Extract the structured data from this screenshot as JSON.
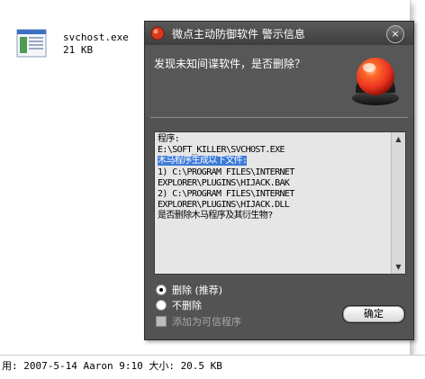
{
  "explorer": {
    "file": {
      "name": "svchost.exe",
      "size": "21 KB"
    },
    "status_text": "用: 2007-5-14 Aaron 9:10 大小: 20.5 KB"
  },
  "dialog": {
    "title": "微点主动防御软件  警示信息",
    "close_label": "×",
    "question": "发现未知间谍软件，是否删除？",
    "message": {
      "lines_before": "程序:\nE:\\SOFT_KILLER\\SVCHOST.EXE\n",
      "highlight": "木马程序生成以下文件:",
      "lines_after": "\n1) C:\\PROGRAM FILES\\INTERNET\nEXPLORER\\PLUGINS\\HIJACK.BAK\n2) C:\\PROGRAM FILES\\INTERNET\nEXPLORER\\PLUGINS\\HIJACK.DLL\n是否删除木马程序及其衍生物?"
    },
    "options": [
      {
        "label": "删除 (推荐)",
        "checked": true
      },
      {
        "label": "不删除",
        "checked": false
      }
    ],
    "trust_checkbox": {
      "label": "添加为可信程序",
      "disabled": true
    },
    "ok_label": "确定",
    "accent_color": "#3d7bd9",
    "alarm_color": "#e8311f"
  }
}
